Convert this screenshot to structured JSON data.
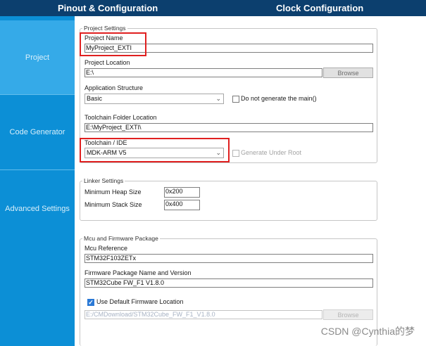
{
  "top_tabs": [
    "Pinout & Configuration",
    "Clock Configuration"
  ],
  "sidebar": {
    "items": [
      "Project",
      "Code Generator",
      "Advanced Settings"
    ],
    "active": "Project"
  },
  "project_settings": {
    "legend": "Project Settings",
    "project_name_label": "Project Name",
    "project_name_value": "MyProject_EXTI",
    "project_location_label": "Project Location",
    "project_location_value": "E:\\",
    "browse_label": "Browse",
    "app_structure_label": "Application Structure",
    "app_structure_value": "Basic",
    "no_main_label": "Do not generate the main()",
    "toolchain_folder_label": "Toolchain Folder Location",
    "toolchain_folder_value": "E:\\MyProject_EXTI\\",
    "toolchain_ide_label": "Toolchain / IDE",
    "toolchain_ide_value": "MDK-ARM V5",
    "generate_under_root_label": "Generate Under Root"
  },
  "linker_settings": {
    "legend": "Linker Settings",
    "heap_label": "Minimum Heap Size",
    "heap_value": "0x200",
    "stack_label": "Minimum Stack Size",
    "stack_value": "0x400"
  },
  "mcu_firmware": {
    "legend": "Mcu and Firmware Package",
    "mcu_ref_label": "Mcu Reference",
    "mcu_ref_value": "STM32F103ZETx",
    "fw_label": "Firmware Package Name and Version",
    "fw_value": "STM32Cube FW_F1 V1.8.0",
    "use_default_label": "Use Default Firmware Location",
    "use_default_checked": true,
    "fw_location_value": "E:/CMDownload/STM32Cube_FW_F1_V1.8.0",
    "browse_label": "Browse"
  },
  "watermark": "CSDN @Cynthia的梦",
  "colors": {
    "topbar": "#0c3f6e",
    "sidebar": "#0c8fd6",
    "sidebar_active": "#35aae8",
    "highlight": "#e02020"
  },
  "icons": {
    "dropdown": "chevron-down-icon",
    "checkbox": "checkbox-icon"
  }
}
